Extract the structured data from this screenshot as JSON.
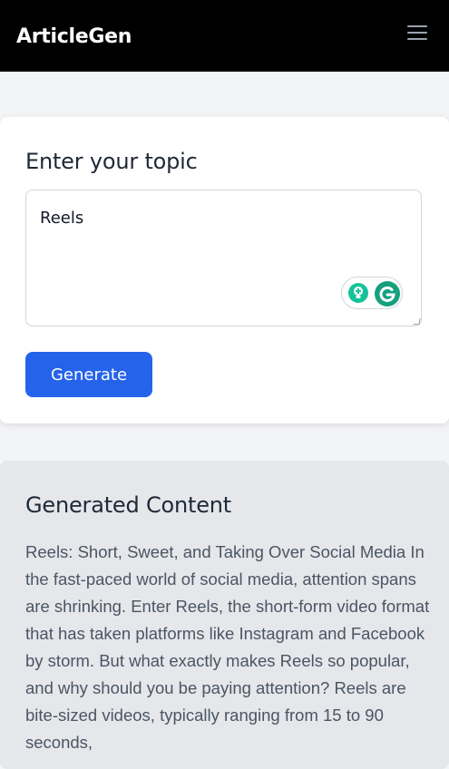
{
  "navbar": {
    "brand": "ArticleGen",
    "menu_icon": "hamburger-menu-icon"
  },
  "topic_form": {
    "title": "Enter your topic",
    "input_value": "Reels",
    "generate_label": "Generate",
    "extension_icons": [
      "grammarly-suggestion-icon",
      "grammarly-logo-icon"
    ]
  },
  "output": {
    "title": "Generated Content",
    "text": "Reels: Short, Sweet, and Taking Over Social Media In the fast-paced world of social media, attention spans are shrinking. Enter Reels, the short-form video format that has taken platforms like Instagram and Facebook by storm. But what exactly makes Reels so popular, and why should you be paying attention? Reels are bite-sized videos, typically ranging from 15 to 90 seconds,"
  },
  "colors": {
    "navbar_bg": "#000000",
    "primary_button": "#2563eb",
    "page_bg": "#f3f4f6",
    "output_bg": "#e5e7eb",
    "grammarly_green": "#15c39a"
  }
}
